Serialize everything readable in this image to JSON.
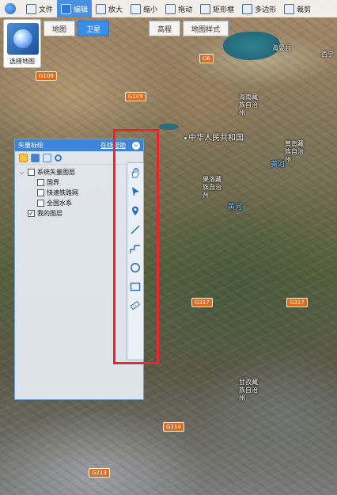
{
  "topbar": {
    "items": [
      {
        "label": "文件",
        "icon": "file-icon",
        "active": false
      },
      {
        "label": "编辑",
        "icon": "edit-icon",
        "active": true
      },
      {
        "label": "放大",
        "icon": "zoom-in-icon",
        "active": false
      },
      {
        "label": "缩小",
        "icon": "zoom-out-icon",
        "active": false
      },
      {
        "label": "拖动",
        "icon": "pan-icon",
        "active": false
      },
      {
        "label": "矩形框",
        "icon": "rectangle-select-icon",
        "active": false
      },
      {
        "label": "多边形",
        "icon": "polygon-select-icon",
        "active": false
      },
      {
        "label": "裁剪",
        "icon": "clip-icon",
        "active": false
      }
    ]
  },
  "map_type": {
    "buttons": [
      {
        "label": "地图",
        "active": false
      },
      {
        "label": "卫星",
        "active": true
      },
      {
        "label": "高程",
        "active": false
      },
      {
        "label": "地图样式",
        "active": false
      }
    ]
  },
  "select_map": {
    "label": "选择地图"
  },
  "panel": {
    "title": "矢量标绘",
    "dock_label": "在线帮助",
    "tree": [
      {
        "label": "系统矢量图层",
        "checked": false,
        "expanded": true,
        "children": [
          {
            "label": "国界",
            "checked": false
          },
          {
            "label": "快速铁路网",
            "checked": false
          },
          {
            "label": "全国水系",
            "checked": false
          }
        ]
      },
      {
        "label": "我的图层",
        "checked": true
      }
    ]
  },
  "draw_tools": [
    "hand-icon",
    "pointer-icon",
    "marker-icon",
    "line-icon",
    "polyline-icon",
    "circle-icon",
    "rectangle-icon",
    "ruler-icon"
  ],
  "map": {
    "labels": [
      {
        "text": "中华人民共和国",
        "class": "big"
      },
      {
        "text": "海南藏族自治州",
        "class": ""
      },
      {
        "text": "黄南藏族自治州",
        "class": ""
      },
      {
        "text": "果洛藏族自治州",
        "class": ""
      },
      {
        "text": "甘孜藏族自治州",
        "class": ""
      },
      {
        "text": "海晏县",
        "class": ""
      },
      {
        "text": "西宁",
        "class": ""
      },
      {
        "text": "黄河",
        "class": "blue"
      },
      {
        "text": "黄河",
        "class": "blue"
      }
    ],
    "roads": [
      "G6",
      "G109",
      "G109",
      "G317",
      "G317",
      "G214",
      "G213"
    ]
  },
  "colors": {
    "accent": "#3d84d8",
    "highlight": "#e8262c",
    "road": "#e06b1f"
  }
}
